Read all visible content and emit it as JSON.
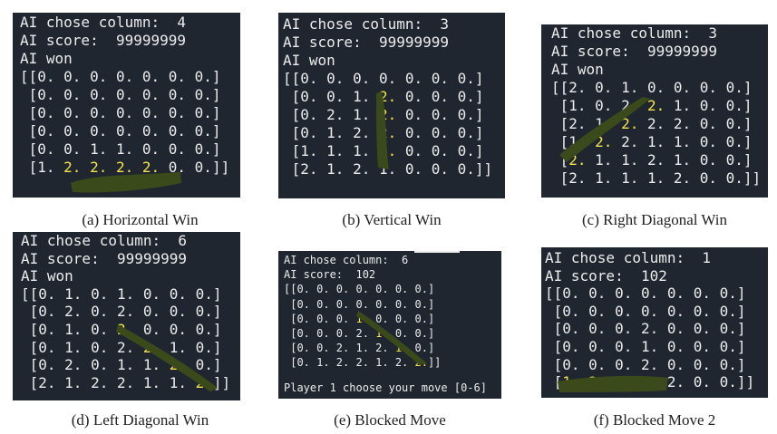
{
  "panels": {
    "a": {
      "caption": "(a) Horizontal Win",
      "lines": {
        "l1": "AI chose column:  4",
        "l2": "AI score:  99999999",
        "l3": "AI won",
        "r0": "[[0. 0. 0. 0. 0. 0. 0.]",
        "r1": " [0. 0. 0. 0. 0. 0. 0.]",
        "r2": " [0. 0. 0. 0. 0. 0. 0.]",
        "r3": " [0. 0. 0. 0. 0. 0. 0.]",
        "r4": " [0. 0. 1. 1. 0. 0. 0.]",
        "r5a": " [1. ",
        "r5b": "2. 2. 2. 2.",
        "r5c": " 0. 0.]]"
      }
    },
    "b": {
      "caption": "(b) Vertical Win",
      "lines": {
        "l1": "AI chose column:  3",
        "l2": "AI score:  99999999",
        "l3": "AI won",
        "r0": "[[0. 0. 0. 0. 0. 0. 0.]",
        "r1a": " [0. 0. 1. ",
        "r1b": "2.",
        "r1c": " 0. 0. 0.]",
        "r2a": " [0. 2. 1. ",
        "r2b": "2.",
        "r2c": " 0. 0. 0.]",
        "r3a": " [0. 1. 2. ",
        "r3b": "2.",
        "r3c": " 0. 0. 0.]",
        "r4a": " [1. 1. 1. ",
        "r4b": "2.",
        "r4c": " 0. 0. 0.]",
        "r5": " [2. 1. 2. 1. 0. 0. 0.]]"
      }
    },
    "c": {
      "caption": "(c) Right Diagonal Win",
      "lines": {
        "l1": "AI chose column:  3",
        "l2": "AI score:  99999999",
        "l3": "AI won",
        "r0": "[[2. 0. 1. 0. 0. 0. 0.]",
        "r1a": " [1. 0. 2. ",
        "r1b": "2.",
        "r1c": " 1. 0. 0.]",
        "r2a": " [2. 1. ",
        "r2b": "2.",
        "r2c": " 2. 2. 0. 0.]",
        "r3a": " [1. ",
        "r3b": "2.",
        "r3c": " 2. 1. 1. 0. 0.]",
        "r4a": " [",
        "r4b": "2.",
        "r4c": " 1. 1. 2. 1. 0. 0.]",
        "r5": " [2. 1. 1. 1. 2. 0. 0.]]"
      }
    },
    "d": {
      "caption": "(d) Left Diagonal Win",
      "lines": {
        "l1": "AI chose column:  6",
        "l2": "AI score:  99999999",
        "l3": "AI won",
        "r0": "[[0. 1. 0. 1. 0. 0. 0.]",
        "r1": " [0. 2. 0. 2. 0. 0. 0.]",
        "r2a": " [0. 1. 0. ",
        "r2b": "2.",
        "r2c": " 0. 0. 0.]",
        "r3a": " [0. 1. 0. 2. ",
        "r3b": "2.",
        "r3c": " 1. 0.]",
        "r4a": " [0. 2. 0. 1. 1. ",
        "r4b": "2.",
        "r4c": " 0.]",
        "r5a": " [2. 1. 2. 2. 1. 1. ",
        "r5b": "2.",
        "r5c": "]]"
      }
    },
    "e": {
      "caption": "(e) Blocked Move",
      "lines": {
        "l1": "AI chose column:  6",
        "l2": "AI score:  102",
        "r0": "[[0. 0. 0. 0. 0. 0. 0.]",
        "r1": " [0. 0. 0. 0. 0. 0. 0.]",
        "r2a": " [0. 0. 0. ",
        "r2b": "1.",
        "r2c": " 0. 0. 0.]",
        "r3a": " [0. 0. 0. 2. ",
        "r3b": "1.",
        "r3c": " 0. 0.]",
        "r4a": " [0. 0. 2. 1. 2. ",
        "r4b": "1.",
        "r4c": " 0.]",
        "r5a": " [0. 1. 2. 2. 1. 2. ",
        "r5b": "2.",
        "r5c": "]]",
        "prompt": "Player 1 choose your move [0-6]"
      }
    },
    "f": {
      "caption": "(f) Blocked Move 2",
      "lines": {
        "l1": "AI chose column:  1",
        "l2": "AI score:  102",
        "r0": "[[0. 0. 0. 0. 0. 0. 0.]",
        "r1": " [0. 0. 0. 0. 0. 0. 0.]",
        "r2": " [0. 0. 0. 2. 0. 0. 0.]",
        "r3": " [0. 0. 0. 1. 0. 0. 0.]",
        "r4": " [0. 0. 0. 2. 0. 0. 0.]",
        "r5a": " [",
        "r5b": "1. 2. 1. 1.",
        "r5c": " 2. 0. 0.]]"
      }
    }
  },
  "colors": {
    "terminal_bg": "#1f2630",
    "terminal_text": "#ececec",
    "highlight_text": "#f5e24b",
    "smear": "#3b4a1a"
  }
}
